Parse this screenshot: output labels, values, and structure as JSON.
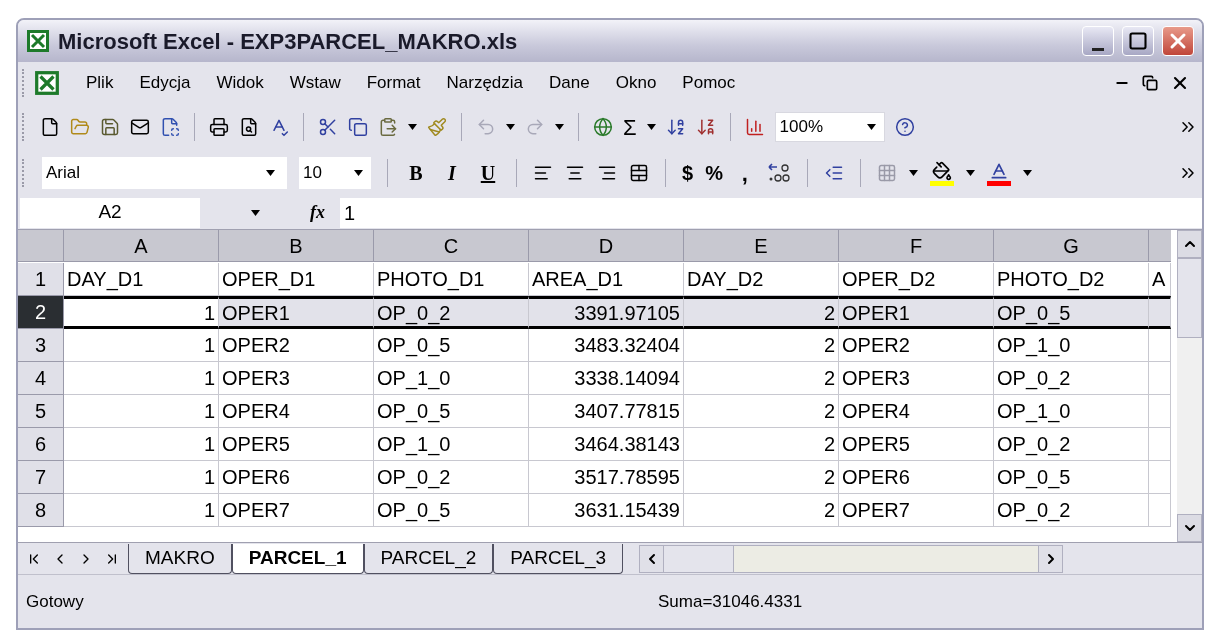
{
  "window": {
    "title": "Microsoft Excel - EXP3PARCEL_MAKRO.xls"
  },
  "menu": [
    "Plik",
    "Edycja",
    "Widok",
    "Wstaw",
    "Format",
    "Narzędzia",
    "Dane",
    "Okno",
    "Pomoc"
  ],
  "standard_toolbar": {
    "sum": "Σ",
    "zoom": "100%"
  },
  "formatting_toolbar": {
    "font": "Arial",
    "size": "10",
    "bold": "B",
    "italic": "I",
    "underline": "U",
    "currency": "$",
    "percent": "%",
    "comma": ","
  },
  "formula_bar": {
    "name_box": "A2",
    "fx": "fx",
    "value": "1"
  },
  "sheet": {
    "columns": [
      {
        "letter": "A",
        "numeric": true
      },
      {
        "letter": "B",
        "numeric": false
      },
      {
        "letter": "C",
        "numeric": false
      },
      {
        "letter": "D",
        "numeric": true
      },
      {
        "letter": "E",
        "numeric": true
      },
      {
        "letter": "F",
        "numeric": false
      },
      {
        "letter": "G",
        "numeric": false
      }
    ],
    "rows": [
      {
        "number": "1",
        "kind": "header",
        "selected": false,
        "cells": [
          "DAY_D1",
          "OPER_D1",
          "PHOTO_D1",
          "AREA_D1",
          "DAY_D2",
          "OPER_D2",
          "PHOTO_D2",
          "A"
        ]
      },
      {
        "number": "2",
        "kind": "data",
        "selected": true,
        "cells": [
          "1",
          "OPER1",
          "OP_0_2",
          "3391.97105",
          "2",
          "OPER1",
          "OP_0_5"
        ]
      },
      {
        "number": "3",
        "kind": "data",
        "selected": false,
        "cells": [
          "1",
          "OPER2",
          "OP_0_5",
          "3483.32404",
          "2",
          "OPER2",
          "OP_1_0"
        ]
      },
      {
        "number": "4",
        "kind": "data",
        "selected": false,
        "cells": [
          "1",
          "OPER3",
          "OP_1_0",
          "3338.14094",
          "2",
          "OPER3",
          "OP_0_2"
        ]
      },
      {
        "number": "5",
        "kind": "data",
        "selected": false,
        "cells": [
          "1",
          "OPER4",
          "OP_0_5",
          "3407.77815",
          "2",
          "OPER4",
          "OP_1_0"
        ]
      },
      {
        "number": "6",
        "kind": "data",
        "selected": false,
        "cells": [
          "1",
          "OPER5",
          "OP_1_0",
          "3464.38143",
          "2",
          "OPER5",
          "OP_0_2"
        ]
      },
      {
        "number": "7",
        "kind": "data",
        "selected": false,
        "cells": [
          "1",
          "OPER6",
          "OP_0_2",
          "3517.78595",
          "2",
          "OPER6",
          "OP_0_5"
        ]
      },
      {
        "number": "8",
        "kind": "data",
        "selected": false,
        "cells": [
          "1",
          "OPER7",
          "OP_0_5",
          "3631.15439",
          "2",
          "OPER7",
          "OP_0_2"
        ]
      }
    ]
  },
  "sheet_tabs": [
    {
      "label": "MAKRO",
      "selected": false
    },
    {
      "label": "PARCEL_1",
      "selected": true
    },
    {
      "label": "PARCEL_2",
      "selected": false
    },
    {
      "label": "PARCEL_3",
      "selected": false
    }
  ],
  "status_bar": {
    "text": "Gotowy",
    "sum": "Suma=31046.4331"
  }
}
